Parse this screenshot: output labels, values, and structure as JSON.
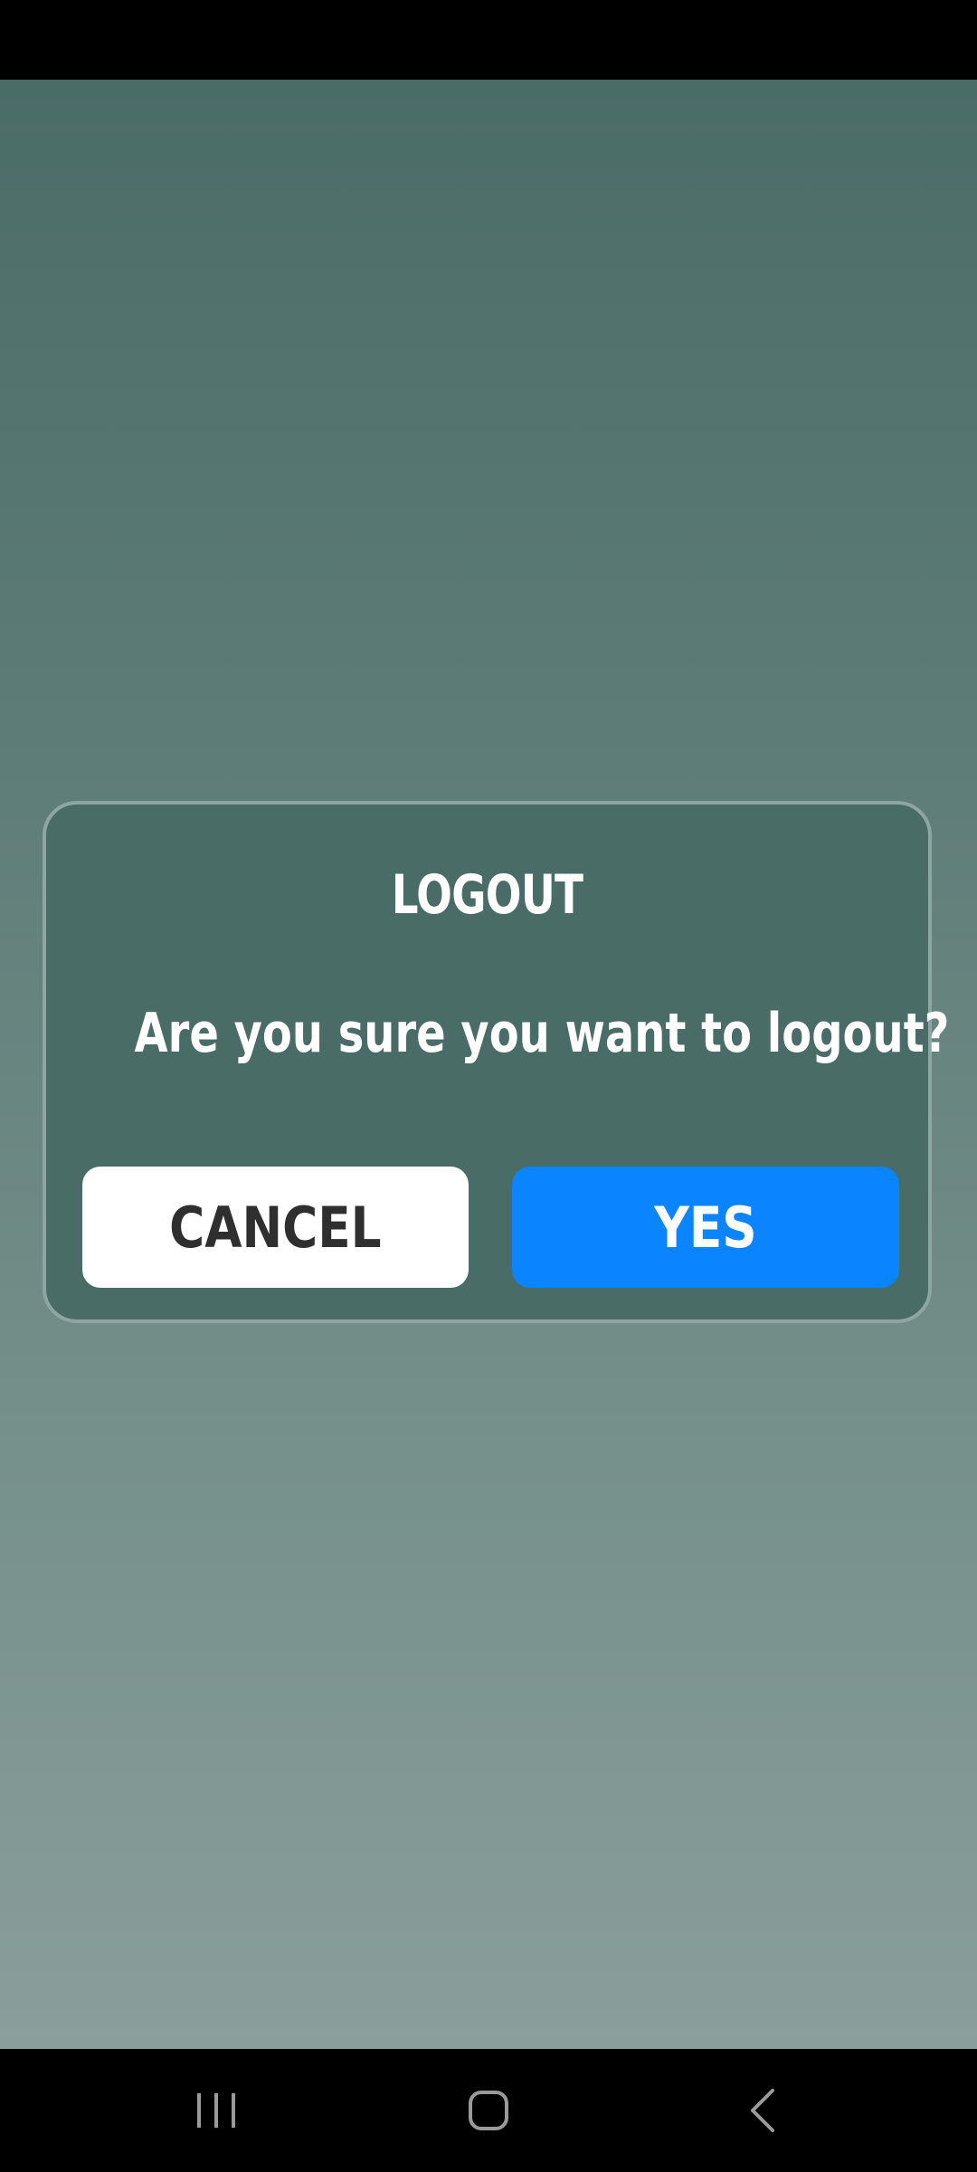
{
  "dialog": {
    "title": "LOGOUT",
    "message": "Are you sure you want to logout?",
    "cancel_label": "CANCEL",
    "confirm_label": "YES"
  },
  "colors": {
    "dialog_bg": "#4a6c67",
    "dialog_border": "#8ea6a2",
    "confirm_button": "#0a84ff",
    "cancel_button": "#ffffff"
  },
  "navigation": {
    "icons": [
      "recents-icon",
      "home-icon",
      "back-icon"
    ]
  }
}
